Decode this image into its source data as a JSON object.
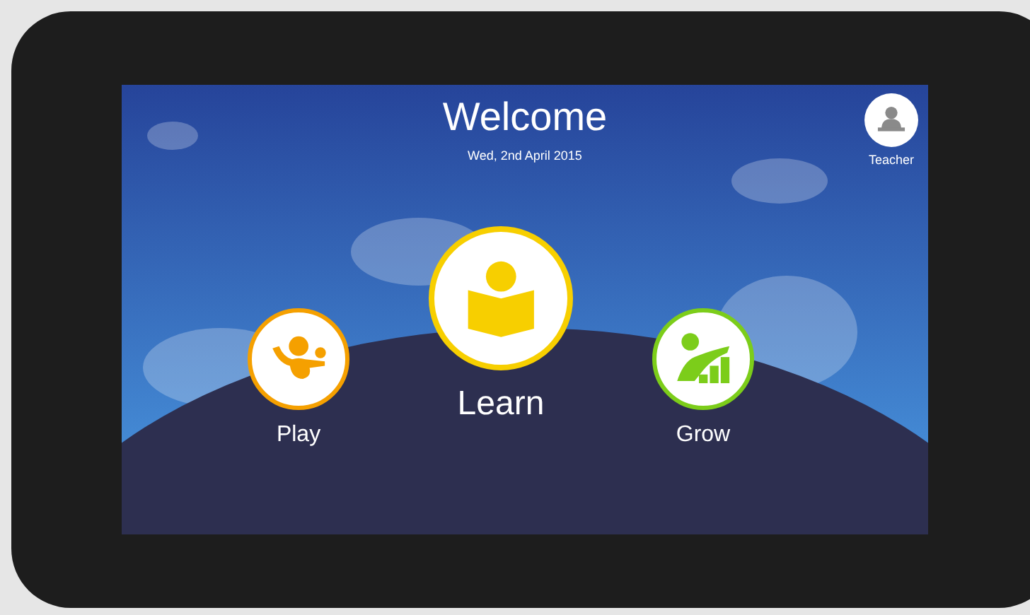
{
  "header": {
    "title": "Welcome",
    "date": "Wed, 2nd April 2015"
  },
  "user": {
    "label": "Teacher"
  },
  "apps": [
    {
      "kind": "play",
      "label": "Play",
      "color": "#f5a000",
      "featured": false
    },
    {
      "kind": "learn",
      "label": "Learn",
      "color": "#f7cf00",
      "featured": true
    },
    {
      "kind": "grow",
      "label": "Grow",
      "color": "#7ccd1a",
      "featured": false
    }
  ]
}
